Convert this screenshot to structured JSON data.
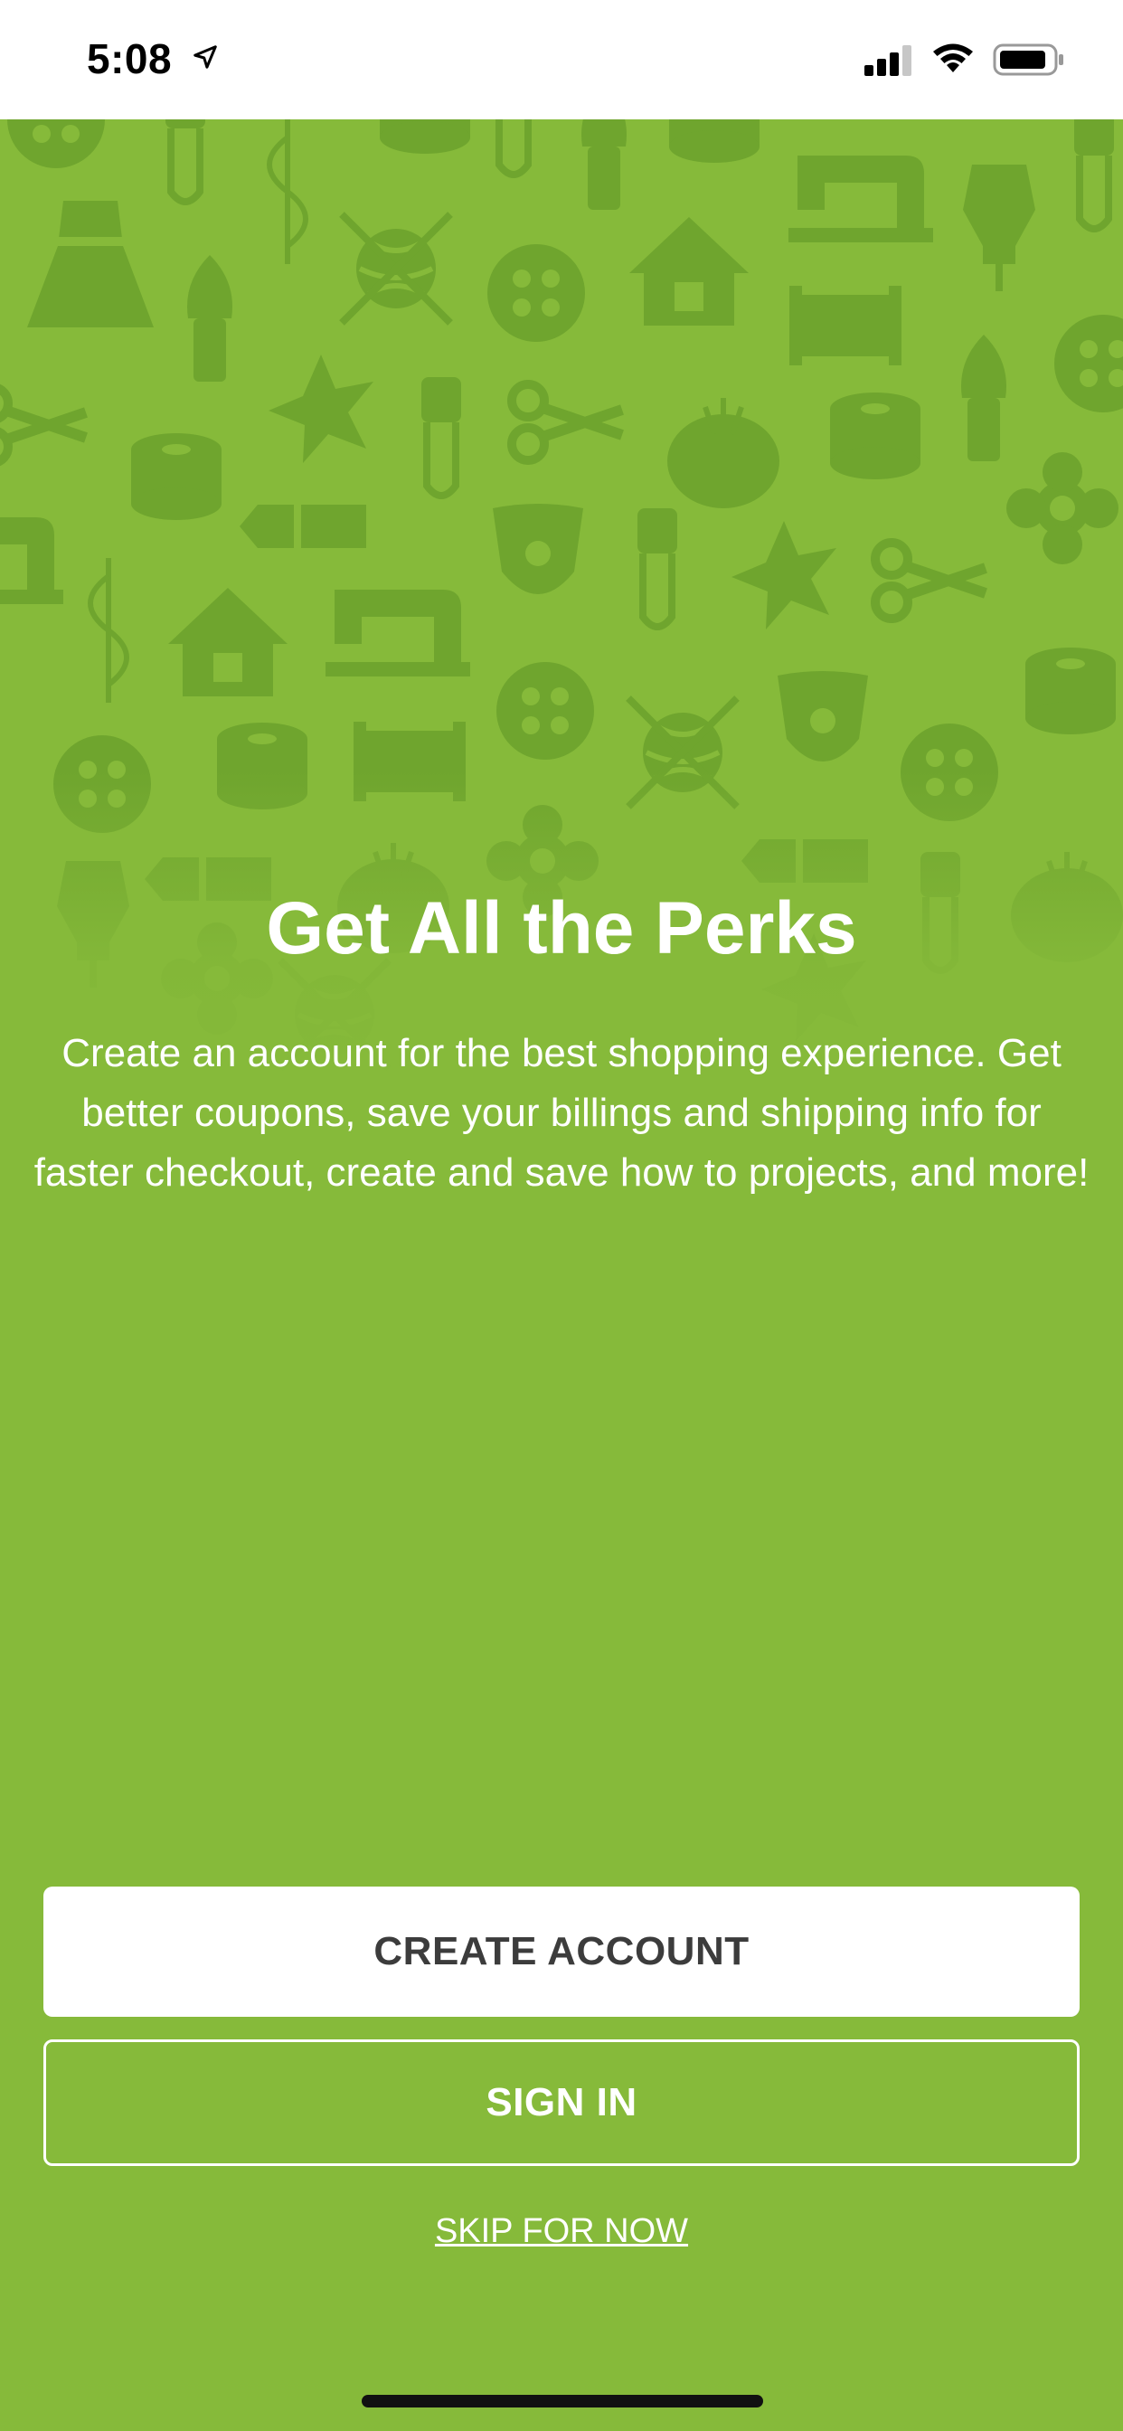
{
  "status_bar": {
    "time": "5:08"
  },
  "onboarding": {
    "title": "Get All the Perks",
    "body": "Create an account for the best shopping experience. Get better coupons, save your billings and shipping info for faster checkout, create and save how to projects, and more!",
    "create_account_label": "CREATE ACCOUNT",
    "sign_in_label": "SIGN IN",
    "skip_label": "SKIP FOR NOW"
  },
  "colors": {
    "background": "#86ba3a",
    "pattern": "#6fa52e",
    "button_text": "#3c3c3c"
  },
  "background_pattern_icons": [
    "dress-form-icon",
    "sewing-machine-icon",
    "yarn-ball-icon",
    "button-icon",
    "house-icon",
    "thread-spool-icon",
    "safety-pin-icon",
    "scissors-icon",
    "pincushion-icon",
    "paintbrush-icon",
    "crayon-icon",
    "star-icon",
    "fabric-bolt-icon",
    "needle-thread-icon",
    "necklace-bust-icon",
    "flower-icon"
  ]
}
